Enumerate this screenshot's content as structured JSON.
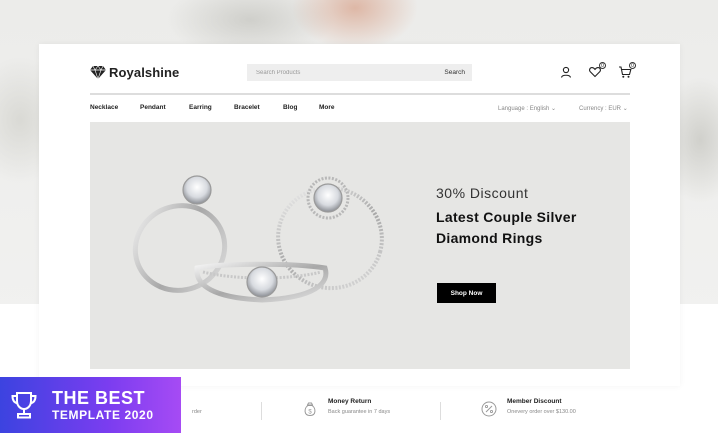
{
  "header": {
    "logo_text": "Royalshine",
    "search_placeholder": "Search Products",
    "search_button": "Search",
    "wishlist_count": "0",
    "cart_count": "0"
  },
  "nav": {
    "items": [
      "Necklace",
      "Pendant",
      "Earring",
      "Bracelet",
      "Blog",
      "More"
    ],
    "language": "Language : English",
    "currency": "Currency : EUR"
  },
  "hero": {
    "subtitle": "30% Discount",
    "title": "Latest Couple Silver Diamond Rings",
    "button": "Shop Now"
  },
  "features": [
    {
      "title": "",
      "desc": "rder",
      "icon": "truck-icon"
    },
    {
      "title": "Money Return",
      "desc": "Back guarantee in 7 days",
      "icon": "money-bag-icon"
    },
    {
      "title": "Member Discount",
      "desc": "Onevery order over $130.00",
      "icon": "percent-icon"
    }
  ],
  "award": {
    "line1": "THE BEST",
    "line2": "TEMPLATE 2020",
    "icon": "trophy-icon"
  },
  "colors": {
    "accent_start": "#3c43e0",
    "accent_end": "#a64bf4",
    "button_bg": "#000000",
    "hero_bg": "#e6e6e4"
  }
}
